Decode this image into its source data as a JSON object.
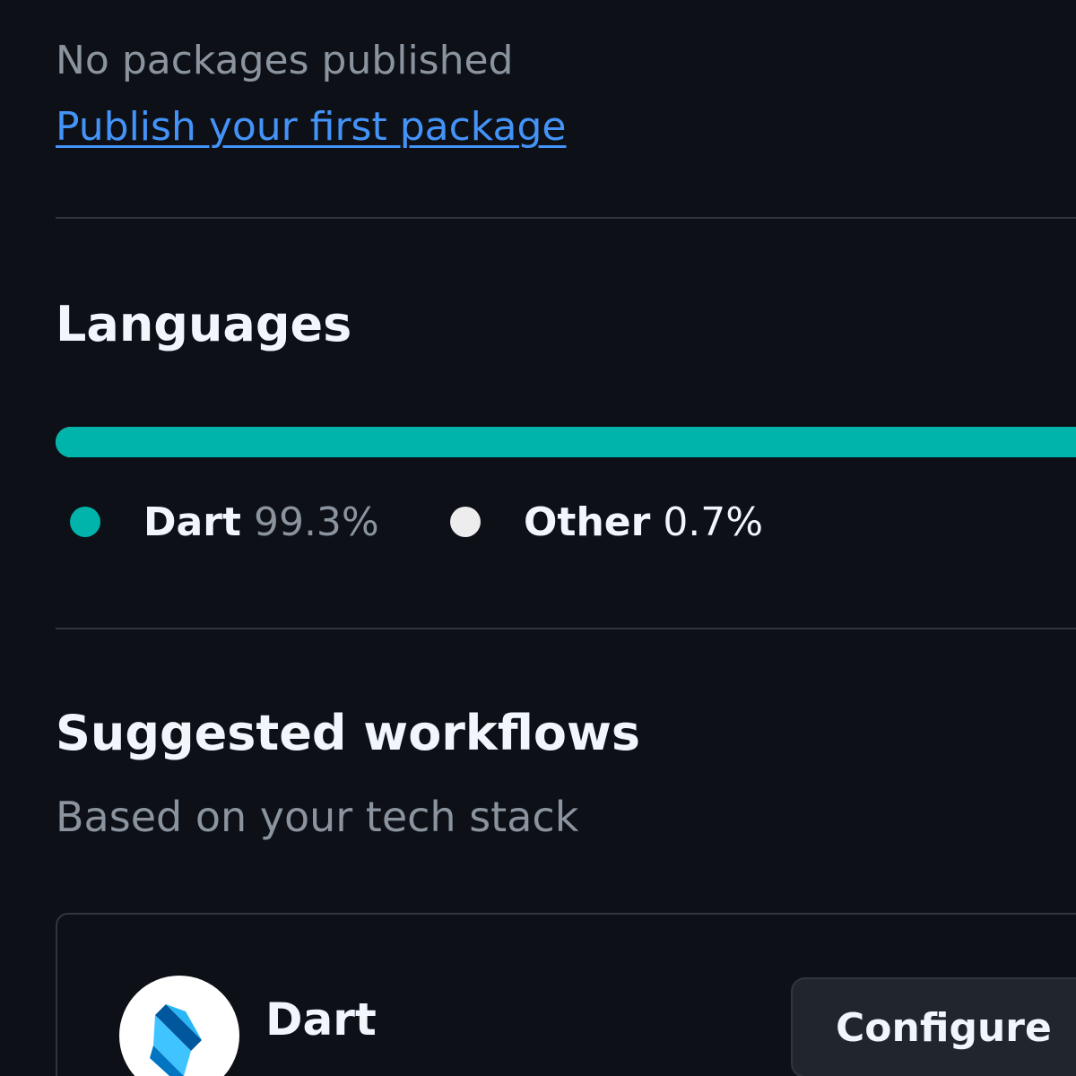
{
  "packages": {
    "empty_text": "No packages published",
    "publish_link": "Publish your first package"
  },
  "languages": {
    "title": "Languages",
    "items": [
      {
        "name": "Dart",
        "percent": "99.3%",
        "value": 99.3,
        "color": "#00b4ab"
      },
      {
        "name": "Other",
        "percent": "0.7%",
        "value": 0.7,
        "color": "#ededed"
      }
    ]
  },
  "workflows": {
    "title": "Suggested workflows",
    "subtitle": "Based on your tech stack",
    "cards": [
      {
        "name": "Dart",
        "icon": "dart-logo-icon",
        "action_label": "Configure"
      }
    ]
  },
  "colors": {
    "background": "#0d1117",
    "link": "#4493f8",
    "border": "#30363d",
    "muted_text": "#8b949e",
    "primary_text": "#f0f6fc"
  }
}
